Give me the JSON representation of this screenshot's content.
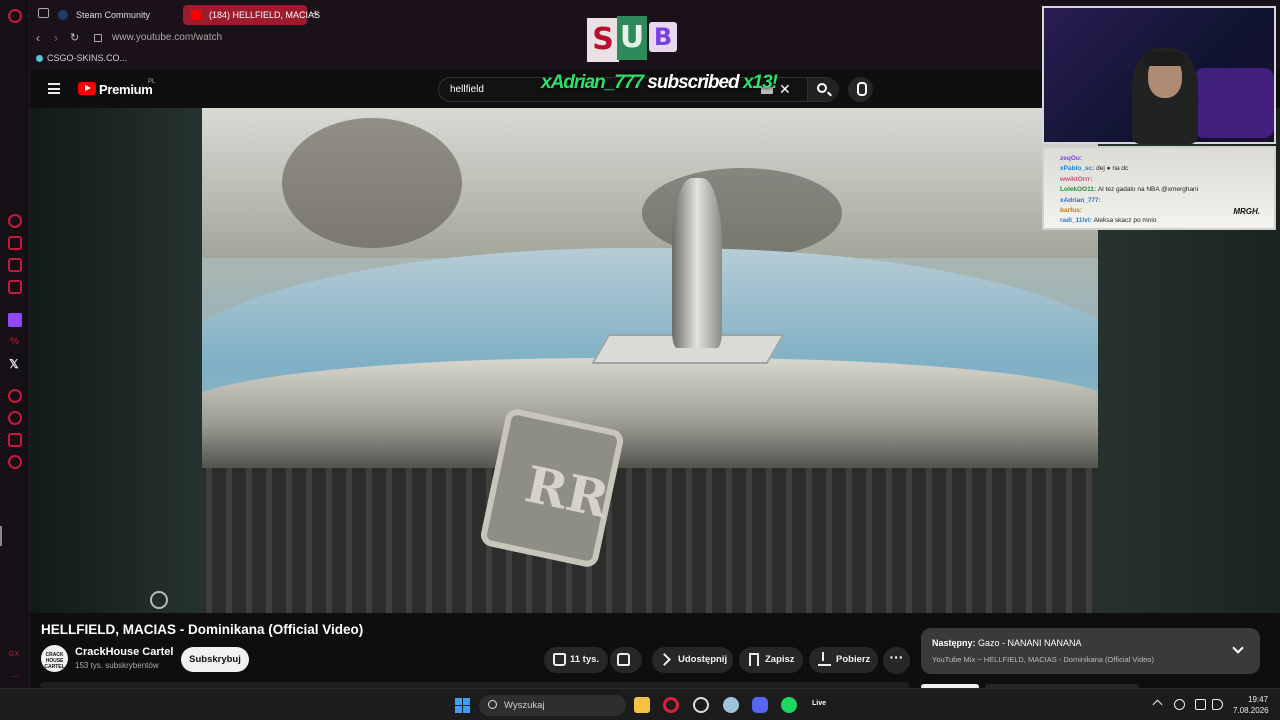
{
  "browser": {
    "tabs": [
      {
        "label": "Steam Community",
        "active": false
      },
      {
        "label": "(184) HELLFIELD, MACIAS",
        "active": true
      }
    ],
    "new_tab": "+",
    "url": "www.youtube.com/watch",
    "bookmark": "CSGO-SKINS.CO..."
  },
  "youtube": {
    "logo_text": "Premium",
    "country": "PL",
    "search_value": "hellfield",
    "search_clear": "✕"
  },
  "overlay": {
    "sub_letters": [
      "S",
      "U",
      "B"
    ],
    "subscriber": "xAdrian_777",
    "subscribed_text": "subscribed",
    "count": "x13!"
  },
  "chat": {
    "lines": [
      {
        "user": "zeqOu:",
        "msg": "",
        "color": "#7a3fe0"
      },
      {
        "user": "xPablo_sc:",
        "msg": "dej ● na dc",
        "color": "#1a7fd0"
      },
      {
        "user": "wwiktOrrr:",
        "msg": "",
        "color": "#d0507a"
      },
      {
        "user": "LolekOO11:",
        "msg": "Al tez gadalo na NBA @xmerghani",
        "color": "#2c8a3b"
      },
      {
        "user": "xAdrian_777:",
        "msg": "",
        "color": "#2c6ed0"
      },
      {
        "user": "barfus:",
        "msg": "",
        "color": "#c07a1a"
      },
      {
        "user": "radi_11lvl:",
        "msg": "Aleksa skacz po mnio",
        "color": "#1a7fd0"
      }
    ],
    "logo": "MRGH."
  },
  "video": {
    "title": "HELLFIELD, MACIAS - Dominikana (Official Video)",
    "badge": "RR",
    "channel": {
      "name": "CrackHouse Cartel",
      "subs": "153 tys. subskrybentów",
      "avatar_text": "CRACK HOUSE CARTEL"
    },
    "subscribe_label": "Subskrybuj",
    "like_count": "11 tys.",
    "share_label": "Udostępnij",
    "save_label": "Zapisz",
    "download_label": "Pobierz",
    "more_label": "···"
  },
  "next": {
    "prefix": "Następny:",
    "title": "Gazo - NANANI NANANA",
    "mix": "YouTube Mix ~ HELLFIELD, MACIAS - Dominikana (Official Video)"
  },
  "taskbar": {
    "search_label": "Wyszukaj",
    "live_label": "Live",
    "time": "19:47",
    "date": "7.08.2026"
  },
  "colors": {
    "opera_red": "#c8193c",
    "youtube_red": "#ff0000",
    "sub_green": "#2ee06b"
  }
}
